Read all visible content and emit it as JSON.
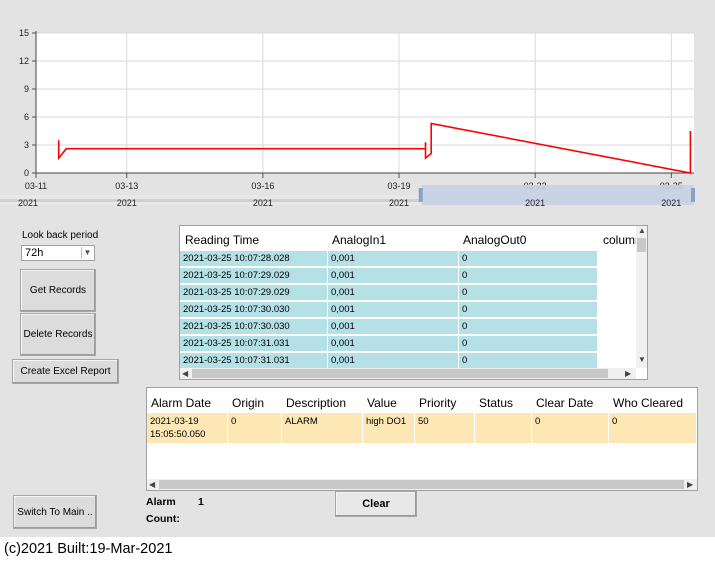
{
  "chart_data": {
    "type": "line",
    "y_ticks": [
      "15",
      "12",
      "9",
      "6",
      "3",
      "0"
    ],
    "ylim": [
      0,
      15
    ],
    "x_ticks": [
      {
        "day": "03-11",
        "year": "2021"
      },
      {
        "day": "03-13",
        "year": "2021"
      },
      {
        "day": "03-16",
        "year": "2021"
      },
      {
        "day": "03-19",
        "year": "2021"
      },
      {
        "day": "03-22",
        "year": "2021"
      },
      {
        "day": "03-25",
        "year": "2021"
      }
    ],
    "xlim": [
      "2021-03-11",
      "2021-03-25 12:00"
    ],
    "series": [
      {
        "color": "#ff0000",
        "points": [
          [
            "2021-03-11 12:00",
            3.5
          ],
          [
            "2021-03-11 12:00",
            1.6
          ],
          [
            "2021-03-11 16:00",
            2.6
          ],
          [
            "2021-03-19 14:00",
            2.6
          ],
          [
            "2021-03-19 14:00",
            3.3
          ],
          [
            "2021-03-19 14:00",
            1.6
          ],
          [
            "2021-03-19 17:00",
            2.1
          ],
          [
            "2021-03-19 17:00",
            5.3
          ],
          [
            "2021-03-25 10:07",
            0.0
          ],
          [
            "2021-03-25 10:07",
            4.5
          ]
        ]
      }
    ],
    "grid": true
  },
  "controls": {
    "look_back_label": "Look back period",
    "look_back_value": "72h",
    "get_records": "Get Records",
    "delete_records": "Delete Records",
    "create_excel": "Create Excel Report",
    "switch_main": "Switch To Main ..",
    "clear": "Clear"
  },
  "readings": {
    "columns": [
      "Reading Time",
      "AnalogIn1",
      "AnalogOut0",
      "column"
    ],
    "rows": [
      [
        "2021-03-25 10:07:28.028",
        "0,001",
        "0"
      ],
      [
        "2021-03-25 10:07:29.029",
        "0,001",
        "0"
      ],
      [
        "2021-03-25 10:07:29.029",
        "0,001",
        "0"
      ],
      [
        "2021-03-25 10:07:30.030",
        "0,001",
        "0"
      ],
      [
        "2021-03-25 10:07:30.030",
        "0,001",
        "0"
      ],
      [
        "2021-03-25 10:07:31.031",
        "0,001",
        "0"
      ],
      [
        "2021-03-25 10:07:31.031",
        "0,001",
        "0"
      ]
    ]
  },
  "alarms": {
    "columns": [
      "Alarm Date",
      "Origin",
      "Description",
      "Value",
      "Priority",
      "Status",
      "Clear Date",
      "Who Cleared"
    ],
    "rows": [
      [
        "2021-03-19 15:05:50.050",
        "0",
        "ALARM",
        "high DO1",
        "50",
        "",
        "0",
        "0"
      ]
    ]
  },
  "alarm_count": {
    "label": "Alarm Count:",
    "value": "1"
  },
  "footer": "(c)2021 Built:19-Mar-2021",
  "colors": {
    "line": "#ff0000",
    "reading_cell": "#b4e0e6",
    "alarm_row": "#fce7b5"
  }
}
